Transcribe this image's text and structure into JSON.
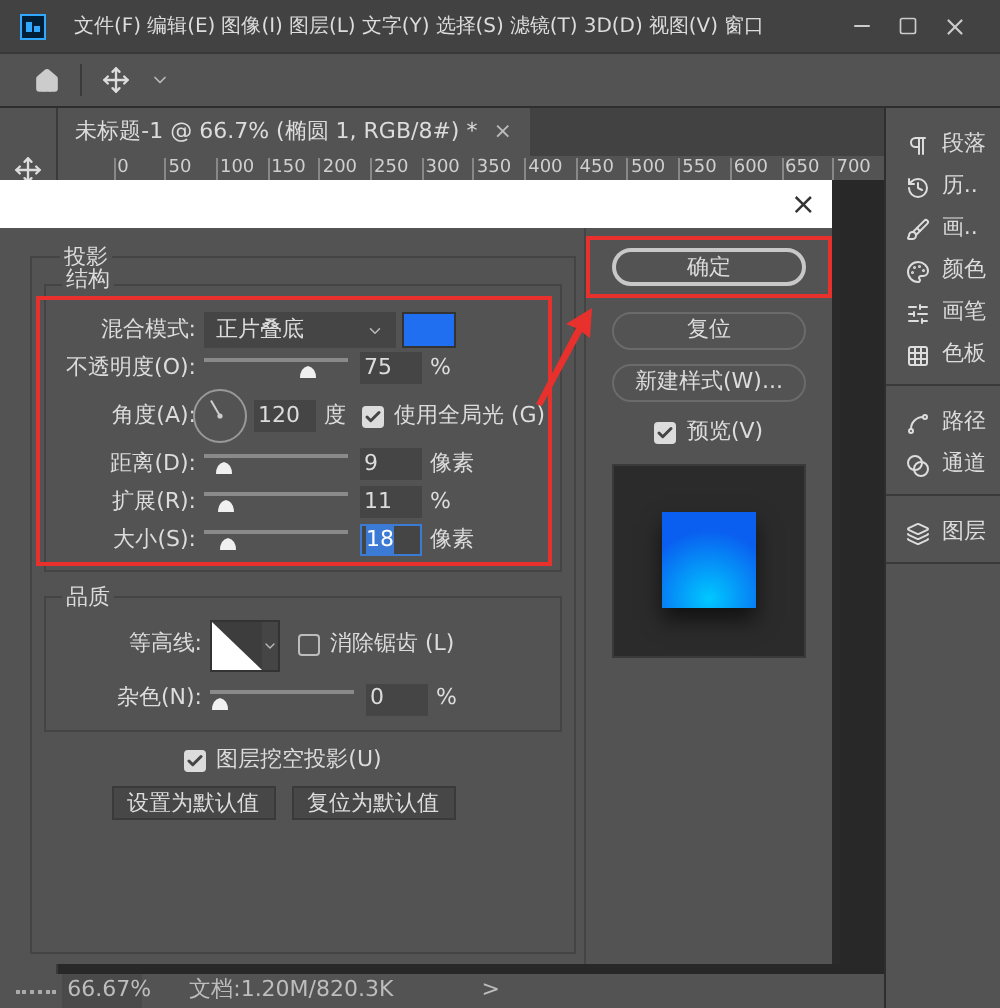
{
  "menu": [
    "文件(F)",
    "编辑(E)",
    "图像(I)",
    "图层(L)",
    "文字(Y)",
    "选择(S)",
    "滤镜(T)",
    "3D(D)",
    "视图(V)",
    "窗口"
  ],
  "document_tab": {
    "title": "未标题-1 @ 66.7% (椭圆 1, RGB/8#) *",
    "close": "×"
  },
  "ruler": [
    "0",
    "50",
    "100",
    "150",
    "200",
    "250",
    "300",
    "350",
    "400",
    "450",
    "500",
    "550",
    "600",
    "650",
    "700"
  ],
  "panel_groups": [
    {
      "items": [
        "段落",
        "历..",
        "画..",
        "颜色",
        "画笔",
        "色板"
      ]
    },
    {
      "items": [
        "路径",
        "通道"
      ]
    },
    {
      "items": [
        "图层"
      ]
    }
  ],
  "dialog": {
    "close": "×",
    "section": "投影",
    "structure": {
      "title": "结构",
      "blend_mode": {
        "label": "混合模式:",
        "value": "正片叠底",
        "color": "#1f6ff0"
      },
      "opacity": {
        "label": "不透明度(O):",
        "level": 0.75,
        "value": "75",
        "unit": "%",
        "selected": false
      },
      "angle": {
        "label": "角度(A):",
        "value": "120",
        "unit": "度",
        "global_light": {
          "label": "使用全局光 (G)",
          "checked": true
        }
      },
      "sliders": [
        {
          "label": "距离(D):",
          "level": 0.08,
          "value": "9",
          "unit": "像素",
          "selected": false
        },
        {
          "label": "扩展(R):",
          "level": 0.1,
          "value": "11",
          "unit": "%",
          "selected": false
        },
        {
          "label": "大小(S):",
          "level": 0.12,
          "value": "18",
          "unit": "像素",
          "selected": true
        }
      ]
    },
    "quality": {
      "title": "品质",
      "contour": {
        "label": "等高线:"
      },
      "anti_alias": {
        "label": "消除锯齿 (L)",
        "checked": false
      },
      "noise": {
        "label": "杂色(N):",
        "level": 0,
        "value": "0",
        "unit": "%"
      }
    },
    "knockout": {
      "label": "图层挖空投影(U)",
      "checked": true
    },
    "default_buttons": [
      "设置为默认值",
      "复位为默认值"
    ],
    "actions": [
      {
        "label": "确定",
        "default": true,
        "highlighted": true
      },
      {
        "label": "复位",
        "default": false,
        "highlighted": false
      },
      {
        "label": "新建样式(W)...",
        "default": false,
        "highlighted": false
      }
    ],
    "preview": {
      "label": "预览(V)",
      "checked": true
    }
  },
  "status_bar": {
    "zoom": "66.67%",
    "document": "文档:1.20M/820.3K",
    "more": ">"
  }
}
